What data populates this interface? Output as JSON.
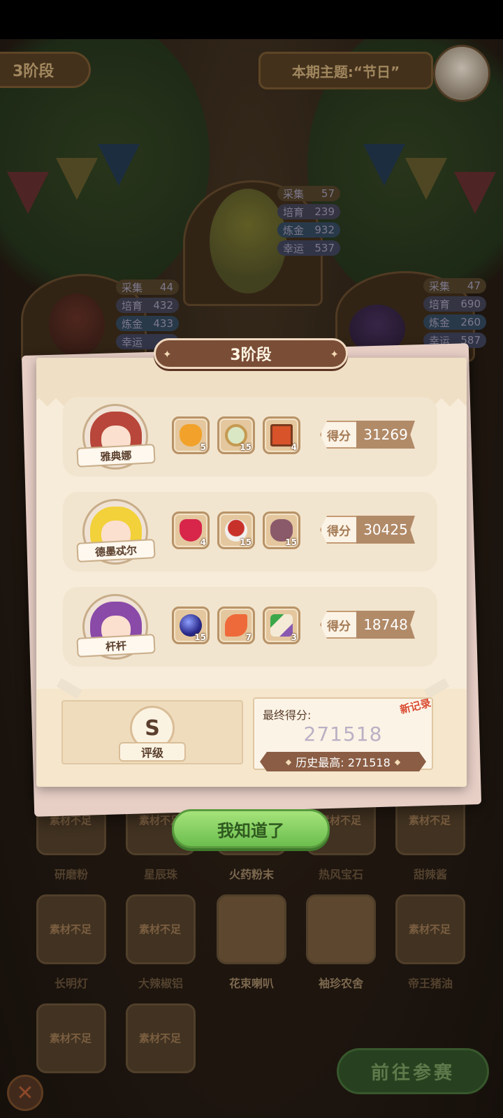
{
  "background": {
    "stage_pill": "3阶段",
    "theme_pill": "本期主题:“节日”",
    "characters": [
      {
        "stats": [
          {
            "label": "采集",
            "value": "57"
          },
          {
            "label": "培育",
            "value": "239"
          },
          {
            "label": "炼金",
            "value": "932"
          },
          {
            "label": "幸运",
            "value": "537"
          }
        ]
      },
      {
        "stats": [
          {
            "label": "采集",
            "value": "44"
          },
          {
            "label": "培育",
            "value": "432"
          },
          {
            "label": "炼金",
            "value": "433"
          },
          {
            "label": "幸运",
            "value": ""
          }
        ]
      },
      {
        "stats": [
          {
            "label": "采集",
            "value": "47"
          },
          {
            "label": "培育",
            "value": "690"
          },
          {
            "label": "炼金",
            "value": "260"
          },
          {
            "label": "幸运",
            "value": "587"
          }
        ]
      }
    ],
    "shop_row1": [
      {
        "tag": "素材不足",
        "label": "研磨粉"
      },
      {
        "tag": "素材不足",
        "label": "星辰珠"
      },
      {
        "tag": "",
        "label": "火药粉末"
      },
      {
        "tag": "素材不足",
        "label": "热风宝石"
      },
      {
        "tag": "素材不足",
        "label": "甜辣酱"
      }
    ],
    "shop_row2": [
      {
        "tag": "素材不足",
        "label": "长明灯"
      },
      {
        "tag": "素材不足",
        "label": "大辣椒铝"
      },
      {
        "tag": "",
        "label": "花束喇叭"
      },
      {
        "tag": "",
        "label": "袖珍农舍"
      },
      {
        "tag": "素材不足",
        "label": "帝王猪油"
      }
    ],
    "shop_row3": [
      {
        "tag": "素材不足"
      },
      {
        "tag": "素材不足"
      }
    ],
    "go_button": "前往参赛"
  },
  "modal": {
    "title": "3阶段",
    "rows": [
      {
        "name": "雅典娜",
        "score_label": "得分",
        "score": "31269",
        "items": [
          {
            "icon": "honey-jar-icon",
            "count": "5"
          },
          {
            "icon": "mirror-icon",
            "count": "15"
          },
          {
            "icon": "book-icon",
            "count": "4"
          }
        ]
      },
      {
        "name": "德墨忒尔",
        "score_label": "得分",
        "score": "30425",
        "items": [
          {
            "icon": "ruby-gem-icon",
            "count": "4"
          },
          {
            "icon": "spice-bowl-icon",
            "count": "15"
          },
          {
            "icon": "vase-icon",
            "count": "15"
          }
        ]
      },
      {
        "name": "杆杆",
        "score_label": "得分",
        "score": "18748",
        "items": [
          {
            "icon": "star-orb-icon",
            "count": "15"
          },
          {
            "icon": "flower-petal-icon",
            "count": "7"
          },
          {
            "icon": "bouquet-horn-icon",
            "count": "3"
          }
        ]
      }
    ],
    "rank_letter": "S",
    "rank_label": "评级",
    "final_label": "最终得分:",
    "final_score": "271518",
    "new_record": "新记录",
    "history_label": "历史最高: 271518",
    "ok_button": "我知道了"
  },
  "colors": {
    "modal_bg": "#f7ecd9",
    "score_value_bg": "#b18a68",
    "ok_button_green": "#6cbe4e",
    "new_record_red": "#d94a2f"
  }
}
